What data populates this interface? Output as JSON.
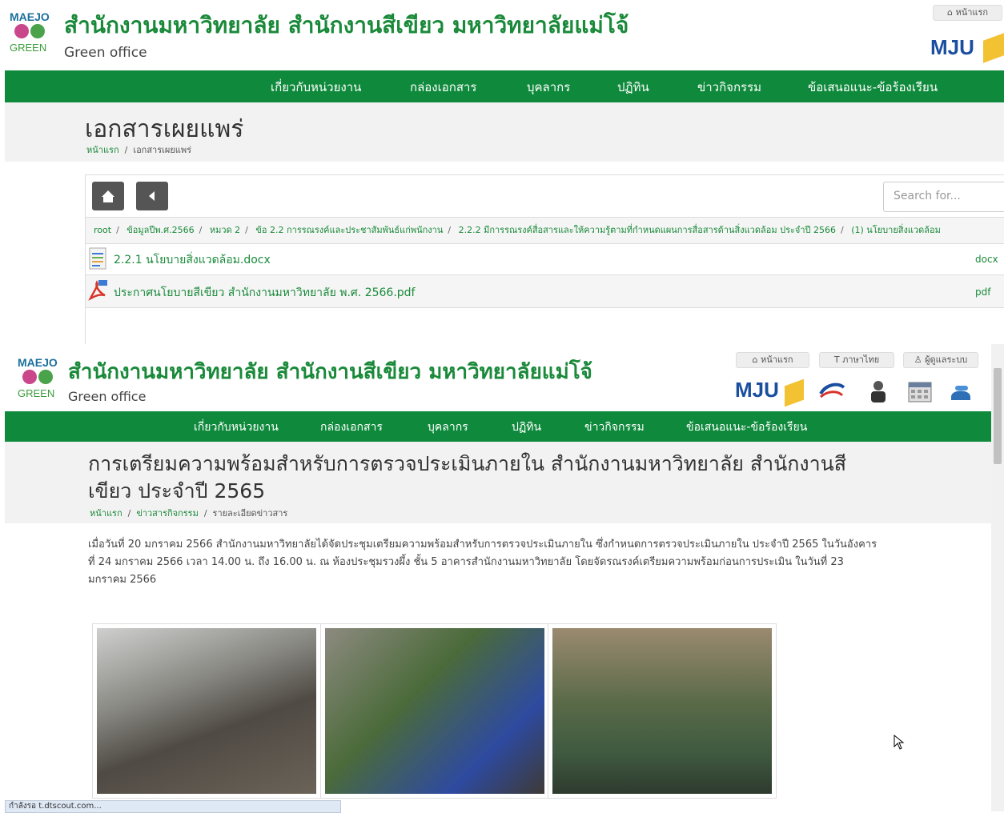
{
  "window1": {
    "org_title": "สำนักงานมหาวิทยาลัย สำนักงานสีเขียว มหาวิทยาลัยแม่โจ้",
    "org_subtitle": "Green office",
    "logo_top": "MAEJO",
    "logo_bottom": "GREEN",
    "home_button": "หน้าแรก",
    "mju_logo": "MJU",
    "nav": [
      "เกี่ยวกับหน่วยงาน",
      "กล่องเอกสาร",
      "บุคลากร",
      "ปฏิทิน",
      "ข่าวกิจกรรม",
      "ข้อเสนอแนะ-ข้อร้องเรียน"
    ],
    "page_title": "เอกสารเผยแพร่",
    "breadcrumb": [
      "หน้าแรก",
      "เอกสารเผยแพร่"
    ],
    "search_placeholder": "Search for...",
    "path": [
      "root",
      "ข้อมูลปีพ.ศ.2566",
      "หมวด 2",
      "ข้อ 2.2 การรณรงค์และประชาสัมพันธ์แก่พนักงาน",
      "2.2.2 มีการรณรงค์สื่อสารและให้ความรู้ตามที่กำหนดแผนการสื่อสารด้านสิ่งแวดล้อม ประจำปี 2566",
      "(1) นโยบายสิ่งแวดล้อม"
    ],
    "files": [
      {
        "name": "2.2.1 นโยบายสิ่งแวดล้อม.docx",
        "ext": "docx",
        "icon": "docx-file-icon"
      },
      {
        "name": "ประกาศนโยบายสีเขียว สำนักงานมหาวิทยาลัย พ.ศ. 2566.pdf",
        "ext": "pdf",
        "icon": "pdf-file-icon"
      }
    ]
  },
  "window2": {
    "org_title": "สำนักงานมหาวิทยาลัย สำนักงานสีเขียว มหาวิทยาลัยแม่โจ้",
    "org_subtitle": "Green office",
    "top_buttons": [
      "หน้าแรก",
      "ภาษาไทย",
      "ผู้ดูแลระบบ"
    ],
    "mju_logo": "MJU",
    "nav": [
      "เกี่ยวกับหน่วยงาน",
      "กล่องเอกสาร",
      "บุคลากร",
      "ปฏิทิน",
      "ข่าวกิจกรรม",
      "ข้อเสนอแนะ-ข้อร้องเรียน"
    ],
    "article_title_line1": "การเตรียมความพร้อมสำหรับการตรวจประเมินภายใน สำนักงานมหาวิทยาลัย สำนักงานสี",
    "article_title_line2": "เขียว ประจำปี 2565",
    "breadcrumb": [
      "หน้าแรก",
      "ข่าวสารกิจกรรม",
      "รายละเอียดข่าวสาร"
    ],
    "body_lines": [
      "เมื่อวันที่ 20 มกราคม 2566 สำนักงานมหาวิทยาลัยได้จัดประชุมเตรียมความพร้อมสำหรับการตรวจประเมินภายใน ซึ่งกำหนดการตรวจประเมินภายใน ประจำปี 2565 ในวันอังคาร",
      "ที่ 24 มกราคม 2566 เวลา 14.00 น. ถึง 16.00 น. ณ ห้องประชุมรวงผึ้ง ชั้น 5 อาคารสำนักงานมหาวิทยาลัย โดยจัดรณรงค์เตรียมความพร้อมก่อนการประเมิน ในวันที่ 23",
      "มกราคม 2566"
    ],
    "status_url": "กำลังรอ t.dtscout.com..."
  }
}
